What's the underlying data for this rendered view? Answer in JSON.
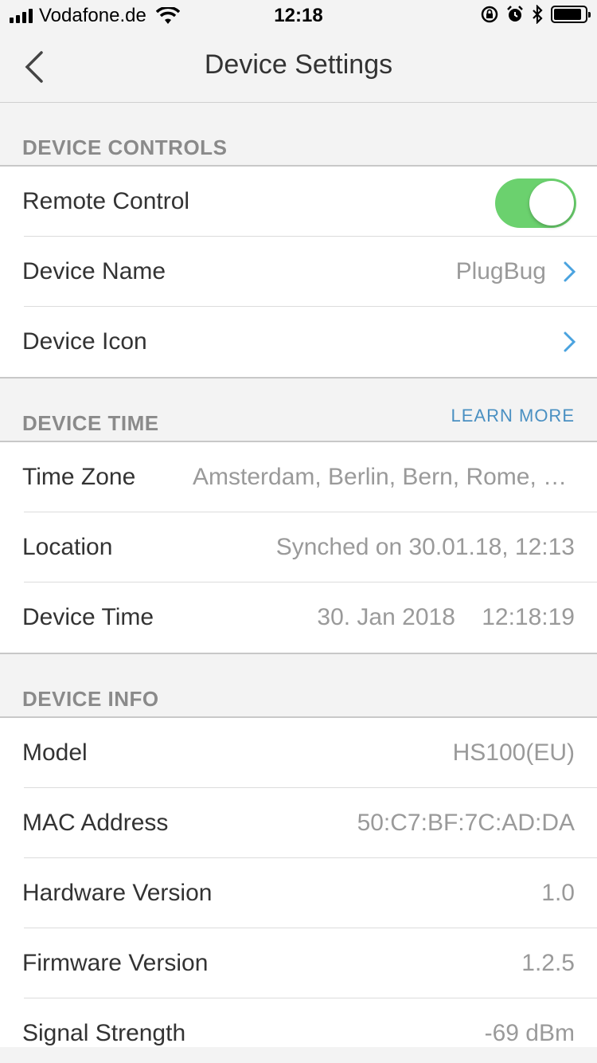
{
  "status_bar": {
    "carrier": "Vodafone.de",
    "time": "12:18",
    "icons": [
      "signal-icon",
      "wifi-icon",
      "orientation-lock-icon",
      "alarm-icon",
      "bluetooth-icon",
      "battery-icon"
    ]
  },
  "nav": {
    "title": "Device Settings",
    "back_icon": "chevron-left-icon"
  },
  "colors": {
    "accent_link": "#4a90c2",
    "toggle_on": "#6bd16e",
    "chevron": "#4aa3df"
  },
  "device_controls": {
    "header": "DEVICE CONTROLS",
    "remote_control": {
      "label": "Remote Control",
      "enabled": true
    },
    "device_name": {
      "label": "Device Name",
      "value": "PlugBug"
    },
    "device_icon": {
      "label": "Device Icon"
    }
  },
  "device_time": {
    "header": "DEVICE TIME",
    "learn_more": "LEARN MORE",
    "rows": [
      {
        "label": "Time Zone",
        "value": "Amsterdam, Berlin, Bern, Rome, Stockholm, Vienna"
      },
      {
        "label": "Location",
        "value": "Synched on 30.01.18, 12:13"
      },
      {
        "label": "Device Time",
        "value": "30. Jan 2018    12:18:19"
      }
    ]
  },
  "device_info": {
    "header": "DEVICE INFO",
    "rows": [
      {
        "label": "Model",
        "value": "HS100(EU)"
      },
      {
        "label": "MAC Address",
        "value": "50:C7:BF:7C:AD:DA"
      },
      {
        "label": "Hardware Version",
        "value": "1.0"
      },
      {
        "label": "Firmware Version",
        "value": "1.2.5"
      },
      {
        "label": "Signal Strength",
        "value": "-69 dBm"
      }
    ]
  }
}
